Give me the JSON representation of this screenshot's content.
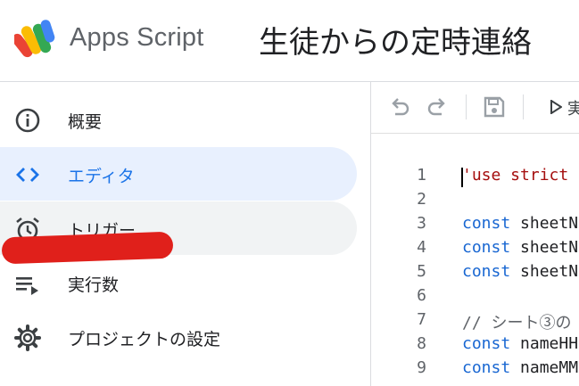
{
  "header": {
    "app_name": "Apps Script",
    "project_title": "生徒からの定時連絡"
  },
  "sidebar": {
    "items": [
      {
        "label": "概要",
        "icon": "info-icon",
        "state": "normal"
      },
      {
        "label": "エディタ",
        "icon": "code-icon",
        "state": "active"
      },
      {
        "label": "トリガー",
        "icon": "alarm-icon",
        "state": "hover"
      },
      {
        "label": "実行数",
        "icon": "playlist-play-icon",
        "state": "normal"
      },
      {
        "label": "プロジェクトの設定",
        "icon": "gear-icon",
        "state": "normal"
      }
    ]
  },
  "toolbar": {
    "undo": "undo-icon",
    "redo": "redo-icon",
    "save": "save-icon",
    "run": "run-icon",
    "run_label_partial": "実"
  },
  "editor": {
    "lines": [
      {
        "n": "1",
        "parts": [
          {
            "t": "'use strict",
            "c": "str"
          }
        ]
      },
      {
        "n": "2",
        "parts": []
      },
      {
        "n": "3",
        "parts": [
          {
            "t": "const",
            "c": "kw"
          },
          {
            "t": " sheetN",
            "c": "id"
          }
        ]
      },
      {
        "n": "4",
        "parts": [
          {
            "t": "const",
            "c": "kw"
          },
          {
            "t": " sheetN",
            "c": "id"
          }
        ]
      },
      {
        "n": "5",
        "parts": [
          {
            "t": "const",
            "c": "kw"
          },
          {
            "t": " sheetN",
            "c": "id"
          }
        ]
      },
      {
        "n": "6",
        "parts": []
      },
      {
        "n": "7",
        "parts": [
          {
            "t": "// シート③の",
            "c": "com"
          }
        ]
      },
      {
        "n": "8",
        "parts": [
          {
            "t": "const",
            "c": "kw"
          },
          {
            "t": " nameHH",
            "c": "id"
          }
        ]
      },
      {
        "n": "9",
        "parts": [
          {
            "t": "const",
            "c": "kw"
          },
          {
            "t": " nameMM",
            "c": "id"
          }
        ]
      }
    ]
  },
  "colors": {
    "accent": "#1a73e8",
    "active_bg": "#e8f0fe",
    "keyword": "#1967d2",
    "string": "#a50e0e",
    "redaction": "#e0201b"
  }
}
